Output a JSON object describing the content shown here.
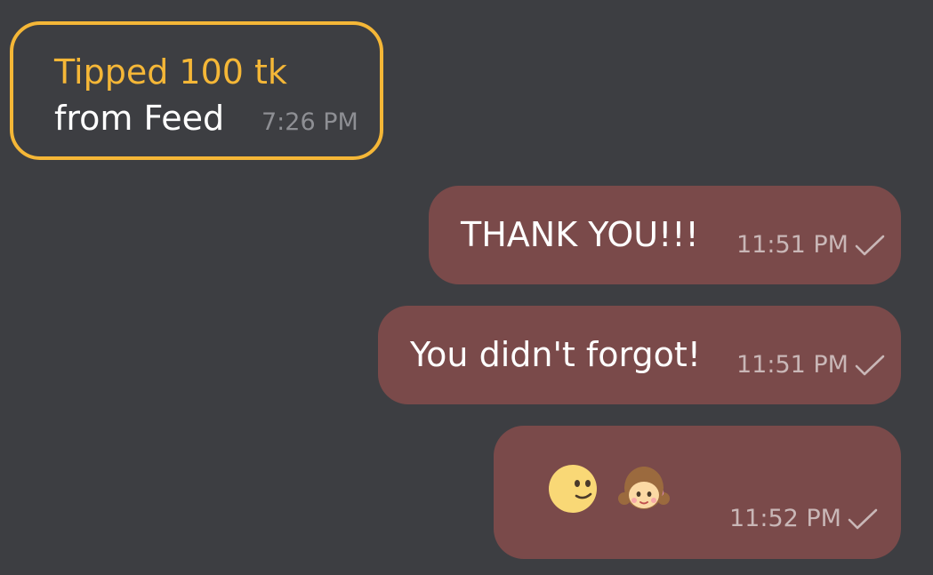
{
  "tip": {
    "title": "Tipped 100 tk",
    "source": "from Feed",
    "time": "7:26 PM",
    "accent_color": "#f5b737"
  },
  "messages": [
    {
      "text": "THANK YOU!!!",
      "time": "11:51 PM",
      "status_icon": "check-icon"
    },
    {
      "text": "You didn't forgot!",
      "time": "11:51 PM",
      "status_icon": "check-icon"
    },
    {
      "emojis": [
        "slightly-smiling-face-emoji",
        "girl-emoji"
      ],
      "time": "11:52 PM",
      "status_icon": "check-icon"
    }
  ],
  "colors": {
    "background": "#3d3e42",
    "outgoing_bubble": "#7a4a4a",
    "text": "#ffffff",
    "timestamp_outgoing": "#c9b7b7",
    "timestamp_incoming": "#8e8f94"
  }
}
